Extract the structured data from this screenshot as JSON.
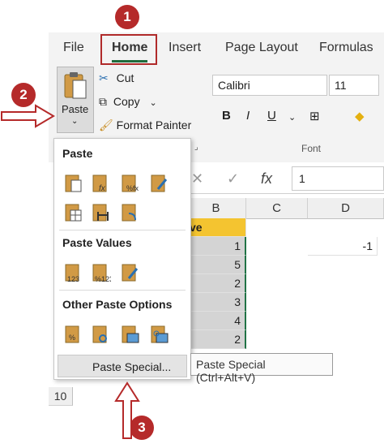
{
  "tabs": {
    "file": "File",
    "home": "Home",
    "insert": "Insert",
    "page_layout": "Page Layout",
    "formulas": "Formulas"
  },
  "clipboard": {
    "paste": "Paste",
    "cut": "Cut",
    "copy": "Copy",
    "format_painter": "Format Painter",
    "paste_chevron": "⌄",
    "copy_chevron": "⌄"
  },
  "font": {
    "name": "Calibri",
    "size": "11",
    "bold": "B",
    "italic": "I",
    "underline": "U",
    "group_label": "Font"
  },
  "formula_bar": {
    "cancel": "✕",
    "enter": "✓",
    "fx": "fx",
    "value": "1"
  },
  "columns": [
    "B",
    "C",
    "D"
  ],
  "rows": [
    "10"
  ],
  "cells": {
    "header_partial": "ve",
    "b_values": [
      "1",
      "5",
      "2",
      "3",
      "4",
      "2"
    ],
    "d_value": "-1"
  },
  "menu": {
    "section_paste": "Paste",
    "section_paste_values": "Paste Values",
    "section_other": "Other Paste Options",
    "paste_special": "Paste Special...",
    "tooltip": "Paste Special (Ctrl+Alt+V)"
  },
  "annotations": {
    "step1": "1",
    "step2": "2",
    "step3": "3"
  },
  "colors": {
    "annotation_red": "#b52a2a",
    "excel_green": "#217346",
    "header_yellow": "#f4c430"
  }
}
